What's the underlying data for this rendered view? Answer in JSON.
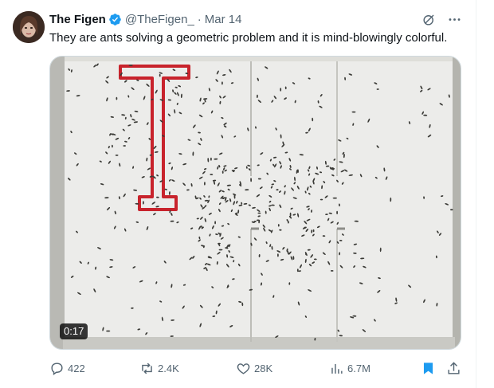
{
  "author": {
    "name": "The Figen",
    "handle": "@TheFigen_",
    "separator": "·",
    "date": "Mar 14",
    "verified": true
  },
  "tweet": {
    "text": "They are ants solving a geometric problem and it is mind-blowingly colorful."
  },
  "media": {
    "type": "video",
    "duration": "0:17"
  },
  "actions": {
    "replies": "422",
    "reposts": "2.4K",
    "likes": "28K",
    "views": "6.7M"
  },
  "colors": {
    "accent": "#1d9bf0",
    "muted": "#536471"
  },
  "icons": [
    "verified-badge-icon",
    "grok-icon",
    "more-icon",
    "reply-icon",
    "repost-icon",
    "like-icon",
    "views-icon",
    "bookmark-icon",
    "share-icon"
  ]
}
